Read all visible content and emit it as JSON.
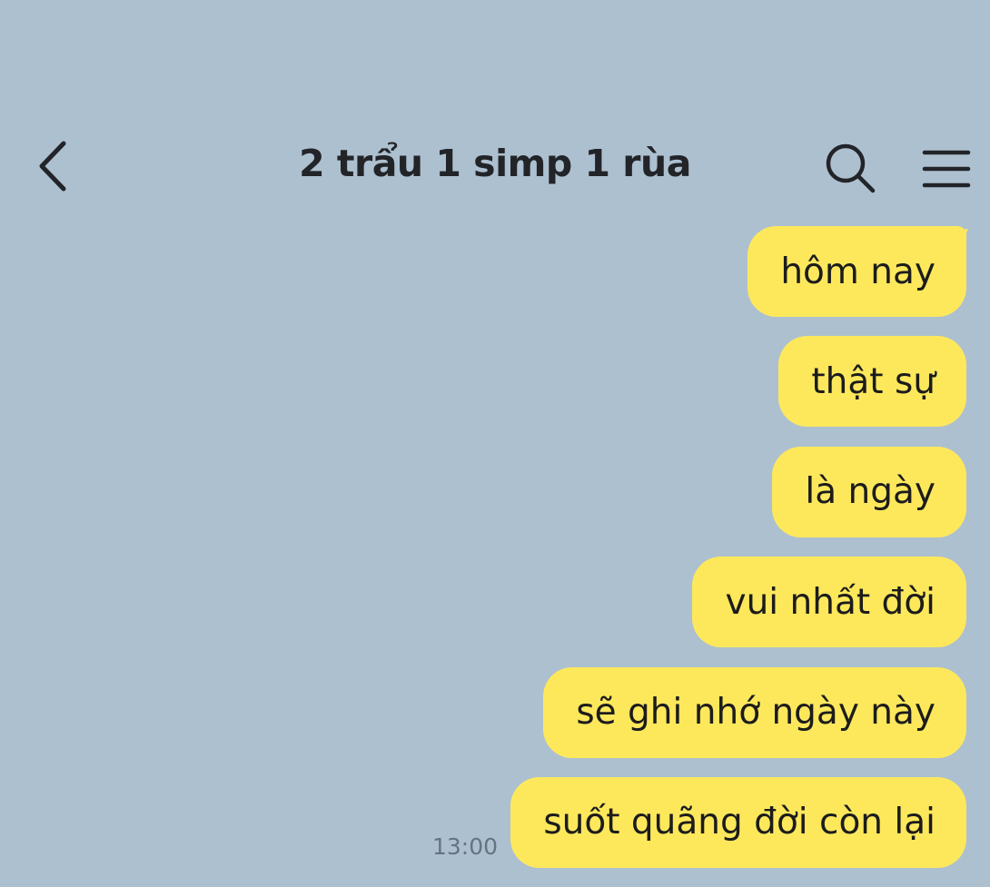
{
  "header": {
    "title": "2 trẩu 1 simp 1 rùa",
    "back_icon": "chevron-left-icon",
    "search_icon": "search-icon",
    "menu_icon": "menu-icon"
  },
  "messages": [
    {
      "text": "hôm nay"
    },
    {
      "text": "thật sự"
    },
    {
      "text": "là ngày"
    },
    {
      "text": "vui nhất đời"
    },
    {
      "text": "sẽ ghi nhớ ngày này"
    },
    {
      "text": "suốt quãng đời còn lại",
      "time": "13:00"
    }
  ],
  "colors": {
    "background": "#adc0d0",
    "bubble": "#fde85c",
    "text": "#1c1c1c",
    "timestamp": "#667380"
  }
}
